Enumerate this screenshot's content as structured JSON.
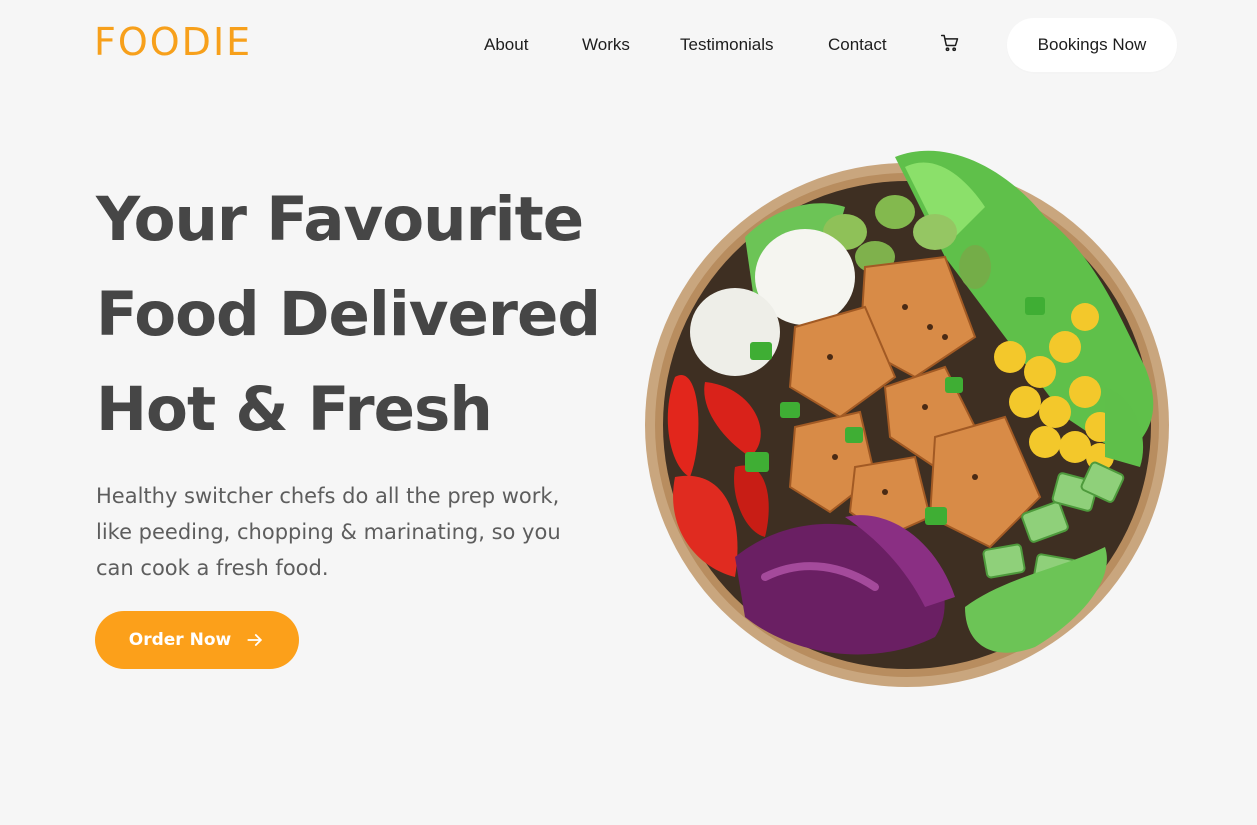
{
  "brand": {
    "logo_text": "FOODIE",
    "accent_color": "#fca01a"
  },
  "nav": {
    "links": [
      {
        "label": "About"
      },
      {
        "label": "Works"
      },
      {
        "label": "Testimonials"
      },
      {
        "label": "Contact"
      }
    ],
    "cart_icon": "shopping-cart-icon",
    "booking_label": "Bookings Now"
  },
  "hero": {
    "title_lines": [
      "Your Favourite",
      "Food Delivered",
      "Hot & Fresh"
    ],
    "description": "Healthy switcher chefs do all the prep work, like peeding, chopping & marinating, so you can cook a fresh food.",
    "cta_label": "Order Now",
    "cta_icon": "arrow-right-icon",
    "image_icon": "salad-bowl-image"
  }
}
